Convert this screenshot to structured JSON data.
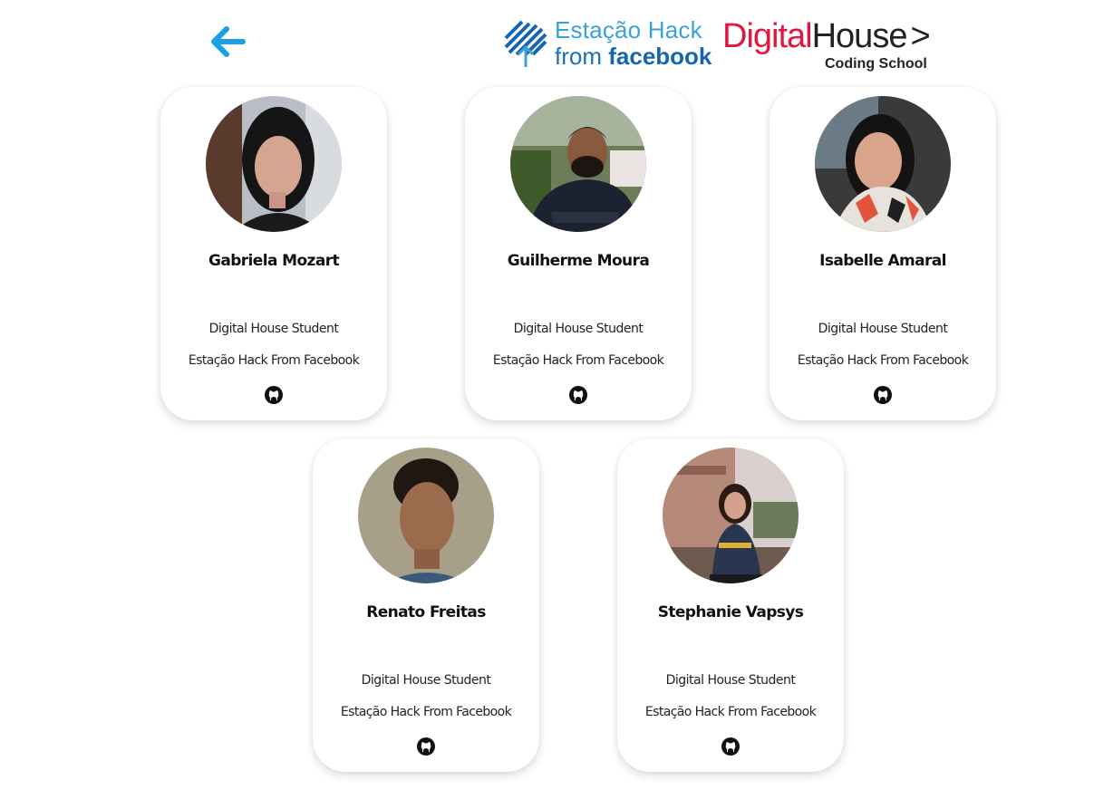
{
  "header": {
    "back_icon": "arrow-left-icon",
    "accent_color": "#1aa0e8",
    "hack_logo": {
      "line1": "Estação Hack",
      "line2_from": "from ",
      "line2_brand": "facebook"
    },
    "dh_logo": {
      "digital": "Digital",
      "house": "House",
      "arrow": ">",
      "sub": "Coding School"
    }
  },
  "cards": [
    {
      "name": "Gabriela Mozart",
      "role": "Digital House Student",
      "org": "Estação Hack From Facebook",
      "icon": "github-icon"
    },
    {
      "name": "Guilherme Moura",
      "role": "Digital House Student",
      "org": "Estação Hack From Facebook",
      "icon": "github-icon"
    },
    {
      "name": "Isabelle Amaral",
      "role": "Digital House Student",
      "org": "Estação Hack From Facebook",
      "icon": "github-icon"
    },
    {
      "name": "Renato Freitas",
      "role": "Digital House Student",
      "org": "Estação Hack From Facebook",
      "icon": "github-icon"
    },
    {
      "name": "Stephanie Vapsys",
      "role": "Digital House Student",
      "org": "Estação Hack From Facebook",
      "icon": "github-icon"
    }
  ]
}
